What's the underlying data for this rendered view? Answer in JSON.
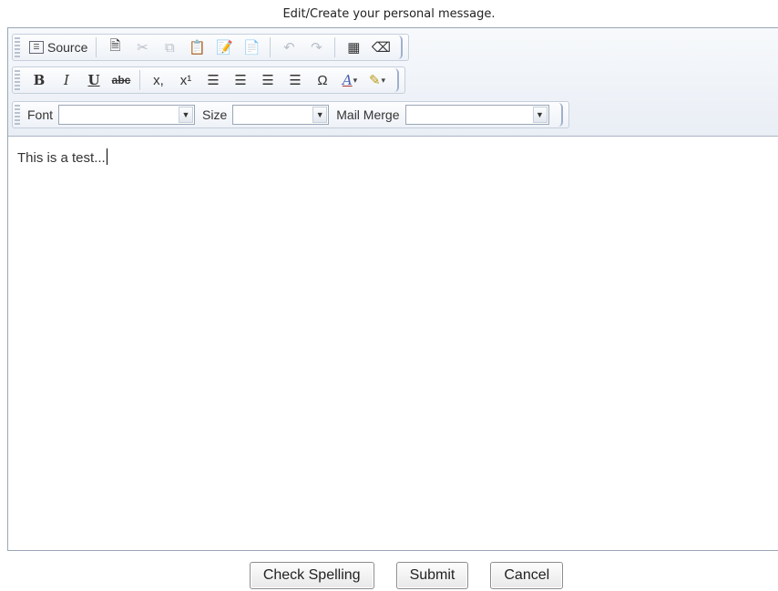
{
  "heading": "Edit/Create your personal message.",
  "toolbar": {
    "source_label": "Source",
    "row1_icons": [
      "new-page-icon",
      "cut-icon",
      "copy-icon",
      "paste-icon",
      "paste-text-icon",
      "paste-word-icon",
      "undo-icon",
      "redo-icon",
      "table-icon",
      "eraser-icon"
    ],
    "bold": "B",
    "italic": "I",
    "underline": "U",
    "strike": "abc",
    "subscript": "x,",
    "superscript": "x¹",
    "special_char": "Ω",
    "text_color": "A",
    "bg_color": "✎",
    "dropdown_caret": "▾",
    "font_label": "Font",
    "font_value": "",
    "size_label": "Size",
    "size_value": "",
    "mailmerge_label": "Mail Merge",
    "mailmerge_value": ""
  },
  "editor": {
    "content": "This is a test..."
  },
  "buttons": {
    "check_spelling": "Check Spelling",
    "submit": "Submit",
    "cancel": "Cancel"
  },
  "colors": {
    "toolbar_bg": "#e9eef5",
    "frame_border": "#9aa7b6"
  }
}
